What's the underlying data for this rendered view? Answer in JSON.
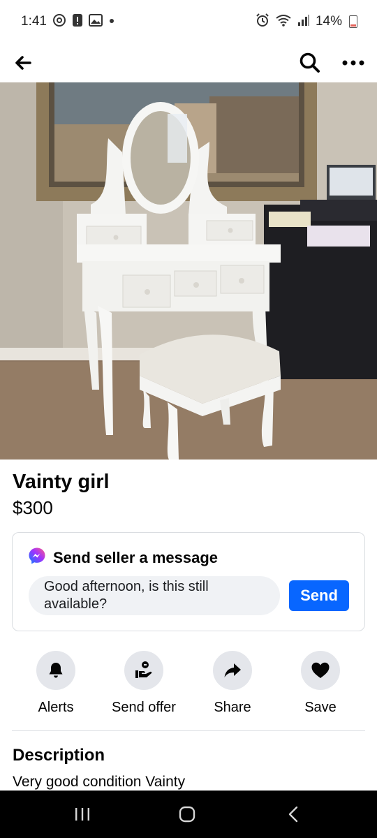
{
  "status_bar": {
    "time": "1:41",
    "battery": "14%",
    "left_icons": [
      "threads-icon",
      "alert-icon",
      "image-icon",
      "dot-icon"
    ],
    "right_icons": [
      "alarm-icon",
      "wifi-icon",
      "signal-icon",
      "battery-icon"
    ]
  },
  "top_nav": {
    "back_icon": "back-arrow-icon",
    "search_icon": "search-icon",
    "more_icon": "more-icon"
  },
  "listing": {
    "photo_description_icon": "listing-photo",
    "title": "Vainty girl",
    "price": "$300"
  },
  "message_card": {
    "icon": "messenger-icon",
    "title": "Send seller a message",
    "input_value": "Good afternoon, is this still available?",
    "send_label": "Send"
  },
  "actions": [
    {
      "label": "Alerts",
      "icon": "bell-icon"
    },
    {
      "label": "Send offer",
      "icon": "offer-icon"
    },
    {
      "label": "Share",
      "icon": "share-icon"
    },
    {
      "label": "Save",
      "icon": "heart-icon"
    }
  ],
  "description": {
    "heading": "Description",
    "text": "Very good condition Vainty"
  },
  "colors": {
    "accent": "#0866ff",
    "card_border": "#dadde1",
    "input_bg": "#f0f2f5",
    "action_circle": "#e4e6eb"
  }
}
